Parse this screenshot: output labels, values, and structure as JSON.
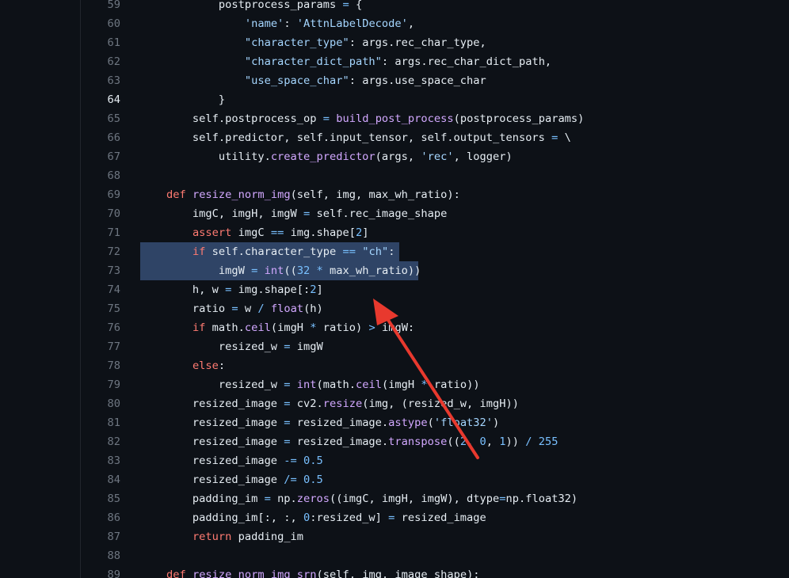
{
  "colors": {
    "background": "#0d1117",
    "line_number": "#6e7681",
    "line_number_active": "#e6edf3",
    "text": "#e6edf3",
    "keyword": "#ff7b72",
    "function": "#d2a8ff",
    "string": "#a5d6ff",
    "number": "#79c0ff",
    "selection": "#2f4466",
    "annotation_arrow": "#e8392e"
  },
  "active_line": 64,
  "selected_lines": [
    72,
    73
  ],
  "code_lines": [
    {
      "n": 59,
      "tokens": [
        [
          "t",
          "            postprocess_params "
        ],
        [
          "o",
          "="
        ],
        [
          "t",
          " {"
        ]
      ]
    },
    {
      "n": 60,
      "tokens": [
        [
          "t",
          "                "
        ],
        [
          "s",
          "'name'"
        ],
        [
          "t",
          ": "
        ],
        [
          "s",
          "'AttnLabelDecode'"
        ],
        [
          "t",
          ","
        ]
      ]
    },
    {
      "n": 61,
      "tokens": [
        [
          "t",
          "                "
        ],
        [
          "s",
          "\"character_type\""
        ],
        [
          "t",
          ": args.rec_char_type,"
        ]
      ]
    },
    {
      "n": 62,
      "tokens": [
        [
          "t",
          "                "
        ],
        [
          "s",
          "\"character_dict_path\""
        ],
        [
          "t",
          ": args.rec_char_dict_path,"
        ]
      ]
    },
    {
      "n": 63,
      "tokens": [
        [
          "t",
          "                "
        ],
        [
          "s",
          "\"use_space_char\""
        ],
        [
          "t",
          ": args.use_space_char"
        ]
      ]
    },
    {
      "n": 64,
      "tokens": [
        [
          "t",
          "            }"
        ]
      ]
    },
    {
      "n": 65,
      "tokens": [
        [
          "t",
          "        self.postprocess_op "
        ],
        [
          "o",
          "="
        ],
        [
          "t",
          " "
        ],
        [
          "f",
          "build_post_process"
        ],
        [
          "t",
          "(postprocess_params)"
        ]
      ]
    },
    {
      "n": 66,
      "tokens": [
        [
          "t",
          "        self.predictor, self.input_tensor, self.output_tensors "
        ],
        [
          "o",
          "="
        ],
        [
          "t",
          " \\"
        ]
      ]
    },
    {
      "n": 67,
      "tokens": [
        [
          "t",
          "            utility."
        ],
        [
          "f",
          "create_predictor"
        ],
        [
          "t",
          "(args, "
        ],
        [
          "s",
          "'rec'"
        ],
        [
          "t",
          ", logger)"
        ]
      ]
    },
    {
      "n": 68,
      "tokens": []
    },
    {
      "n": 69,
      "tokens": [
        [
          "t",
          "    "
        ],
        [
          "k",
          "def"
        ],
        [
          "t",
          " "
        ],
        [
          "f",
          "resize_norm_img"
        ],
        [
          "t",
          "(self, img, max_wh_ratio):"
        ]
      ]
    },
    {
      "n": 70,
      "tokens": [
        [
          "t",
          "        imgC, imgH, imgW "
        ],
        [
          "o",
          "="
        ],
        [
          "t",
          " self.rec_image_shape"
        ]
      ]
    },
    {
      "n": 71,
      "tokens": [
        [
          "t",
          "        "
        ],
        [
          "k",
          "assert"
        ],
        [
          "t",
          " imgC "
        ],
        [
          "o",
          "=="
        ],
        [
          "t",
          " img.shape["
        ],
        [
          "n",
          "2"
        ],
        [
          "t",
          "]"
        ]
      ]
    },
    {
      "n": 72,
      "tokens": [
        [
          "t",
          "        "
        ],
        [
          "k",
          "if"
        ],
        [
          "t",
          " self.character_type "
        ],
        [
          "o",
          "=="
        ],
        [
          "t",
          " "
        ],
        [
          "s",
          "\"ch\""
        ],
        [
          "t",
          ":"
        ]
      ]
    },
    {
      "n": 73,
      "tokens": [
        [
          "t",
          "            imgW "
        ],
        [
          "o",
          "="
        ],
        [
          "t",
          " "
        ],
        [
          "f",
          "int"
        ],
        [
          "t",
          "(("
        ],
        [
          "n",
          "32"
        ],
        [
          "t",
          " "
        ],
        [
          "o",
          "*"
        ],
        [
          "t",
          " max_wh_ratio))"
        ]
      ]
    },
    {
      "n": 74,
      "tokens": [
        [
          "t",
          "        h, w "
        ],
        [
          "o",
          "="
        ],
        [
          "t",
          " img.shape[:"
        ],
        [
          "n",
          "2"
        ],
        [
          "t",
          "]"
        ]
      ]
    },
    {
      "n": 75,
      "tokens": [
        [
          "t",
          "        ratio "
        ],
        [
          "o",
          "="
        ],
        [
          "t",
          " w "
        ],
        [
          "o",
          "/"
        ],
        [
          "t",
          " "
        ],
        [
          "f",
          "float"
        ],
        [
          "t",
          "(h)"
        ]
      ]
    },
    {
      "n": 76,
      "tokens": [
        [
          "t",
          "        "
        ],
        [
          "k",
          "if"
        ],
        [
          "t",
          " math."
        ],
        [
          "f",
          "ceil"
        ],
        [
          "t",
          "(imgH "
        ],
        [
          "o",
          "*"
        ],
        [
          "t",
          " ratio) "
        ],
        [
          "o",
          ">"
        ],
        [
          "t",
          " imgW:"
        ]
      ]
    },
    {
      "n": 77,
      "tokens": [
        [
          "t",
          "            resized_w "
        ],
        [
          "o",
          "="
        ],
        [
          "t",
          " imgW"
        ]
      ]
    },
    {
      "n": 78,
      "tokens": [
        [
          "t",
          "        "
        ],
        [
          "k",
          "else"
        ],
        [
          "t",
          ":"
        ]
      ]
    },
    {
      "n": 79,
      "tokens": [
        [
          "t",
          "            resized_w "
        ],
        [
          "o",
          "="
        ],
        [
          "t",
          " "
        ],
        [
          "f",
          "int"
        ],
        [
          "t",
          "(math."
        ],
        [
          "f",
          "ceil"
        ],
        [
          "t",
          "(imgH "
        ],
        [
          "o",
          "*"
        ],
        [
          "t",
          " ratio))"
        ]
      ]
    },
    {
      "n": 80,
      "tokens": [
        [
          "t",
          "        resized_image "
        ],
        [
          "o",
          "="
        ],
        [
          "t",
          " cv2."
        ],
        [
          "f",
          "resize"
        ],
        [
          "t",
          "(img, (resized_w, imgH))"
        ]
      ]
    },
    {
      "n": 81,
      "tokens": [
        [
          "t",
          "        resized_image "
        ],
        [
          "o",
          "="
        ],
        [
          "t",
          " resized_image."
        ],
        [
          "f",
          "astype"
        ],
        [
          "t",
          "("
        ],
        [
          "s",
          "'float32'"
        ],
        [
          "t",
          ")"
        ]
      ]
    },
    {
      "n": 82,
      "tokens": [
        [
          "t",
          "        resized_image "
        ],
        [
          "o",
          "="
        ],
        [
          "t",
          " resized_image."
        ],
        [
          "f",
          "transpose"
        ],
        [
          "t",
          "(("
        ],
        [
          "n",
          "2"
        ],
        [
          "t",
          ", "
        ],
        [
          "n",
          "0"
        ],
        [
          "t",
          ", "
        ],
        [
          "n",
          "1"
        ],
        [
          "t",
          ")) "
        ],
        [
          "o",
          "/"
        ],
        [
          "t",
          " "
        ],
        [
          "n",
          "255"
        ]
      ]
    },
    {
      "n": 83,
      "tokens": [
        [
          "t",
          "        resized_image "
        ],
        [
          "o",
          "-="
        ],
        [
          "t",
          " "
        ],
        [
          "n",
          "0.5"
        ]
      ]
    },
    {
      "n": 84,
      "tokens": [
        [
          "t",
          "        resized_image "
        ],
        [
          "o",
          "/="
        ],
        [
          "t",
          " "
        ],
        [
          "n",
          "0.5"
        ]
      ]
    },
    {
      "n": 85,
      "tokens": [
        [
          "t",
          "        padding_im "
        ],
        [
          "o",
          "="
        ],
        [
          "t",
          " np."
        ],
        [
          "f",
          "zeros"
        ],
        [
          "t",
          "((imgC, imgH, imgW), dtype"
        ],
        [
          "o",
          "="
        ],
        [
          "t",
          "np.float32)"
        ]
      ]
    },
    {
      "n": 86,
      "tokens": [
        [
          "t",
          "        padding_im[:, :, "
        ],
        [
          "n",
          "0"
        ],
        [
          "t",
          ":resized_w] "
        ],
        [
          "o",
          "="
        ],
        [
          "t",
          " resized_image"
        ]
      ]
    },
    {
      "n": 87,
      "tokens": [
        [
          "t",
          "        "
        ],
        [
          "k",
          "return"
        ],
        [
          "t",
          " padding_im"
        ]
      ]
    },
    {
      "n": 88,
      "tokens": []
    },
    {
      "n": 89,
      "tokens": [
        [
          "t",
          "    "
        ],
        [
          "k",
          "def"
        ],
        [
          "t",
          " "
        ],
        [
          "f",
          "resize_norm_img_srn"
        ],
        [
          "t",
          "(self, img, image_shape):"
        ]
      ]
    }
  ]
}
